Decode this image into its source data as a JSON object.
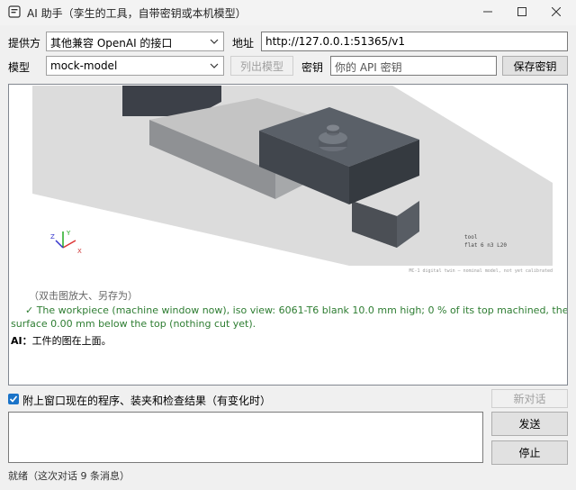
{
  "window": {
    "title": "AI 助手（孪生的工具，自带密钥或本机模型）"
  },
  "row1": {
    "provider_label": "提供方",
    "provider_value": "其他兼容 OpenAI 的接口",
    "address_label": "地址",
    "address_value": "http://127.0.0.1:51365/v1"
  },
  "row2": {
    "model_label": "模型",
    "model_value": "mock-model",
    "list_models_label": "列出模型",
    "key_label": "密钥",
    "key_placeholder": "你的 API 密钥",
    "save_key_label": "保存密钥"
  },
  "viewport": {
    "tool_label_1": "tool",
    "tool_label_2": "flat 6 n3 L20",
    "footer_note": "MC-1 digital twin — nominal model, not yet calibrated",
    "axis_x": "X",
    "axis_y": "Y",
    "axis_z": "Z"
  },
  "chat": {
    "hint": "（双击图放大、另存为）",
    "status_line1": "✓ The workpiece (machine window now), iso view: 6061-T6 blank 10.0 mm high; 0 % of its top machined, the deepest",
    "status_line2": "surface 0.00 mm below the top (nothing cut yet).",
    "ai_prefix": "AI：",
    "ai_message": "工件的图在上面。"
  },
  "attach": {
    "label": "附上窗口现在的程序、装夹和检查结果（有变化时）",
    "checked": true
  },
  "buttons": {
    "new_chat": "新对话",
    "send": "发送",
    "stop": "停止"
  },
  "status_bar": {
    "text": "就绪（这次对话 9 条消息）"
  },
  "colors": {
    "accent": "#1a73c8",
    "success_text": "#2e7d32",
    "stock": "#a9acae",
    "fixture": "#4a4f57"
  },
  "icons": {
    "app": "app-icon",
    "minimize": "minimize-icon",
    "maximize": "maximize-icon",
    "close": "close-icon",
    "dropdown": "chevron-down-icon",
    "check": "check-icon"
  }
}
